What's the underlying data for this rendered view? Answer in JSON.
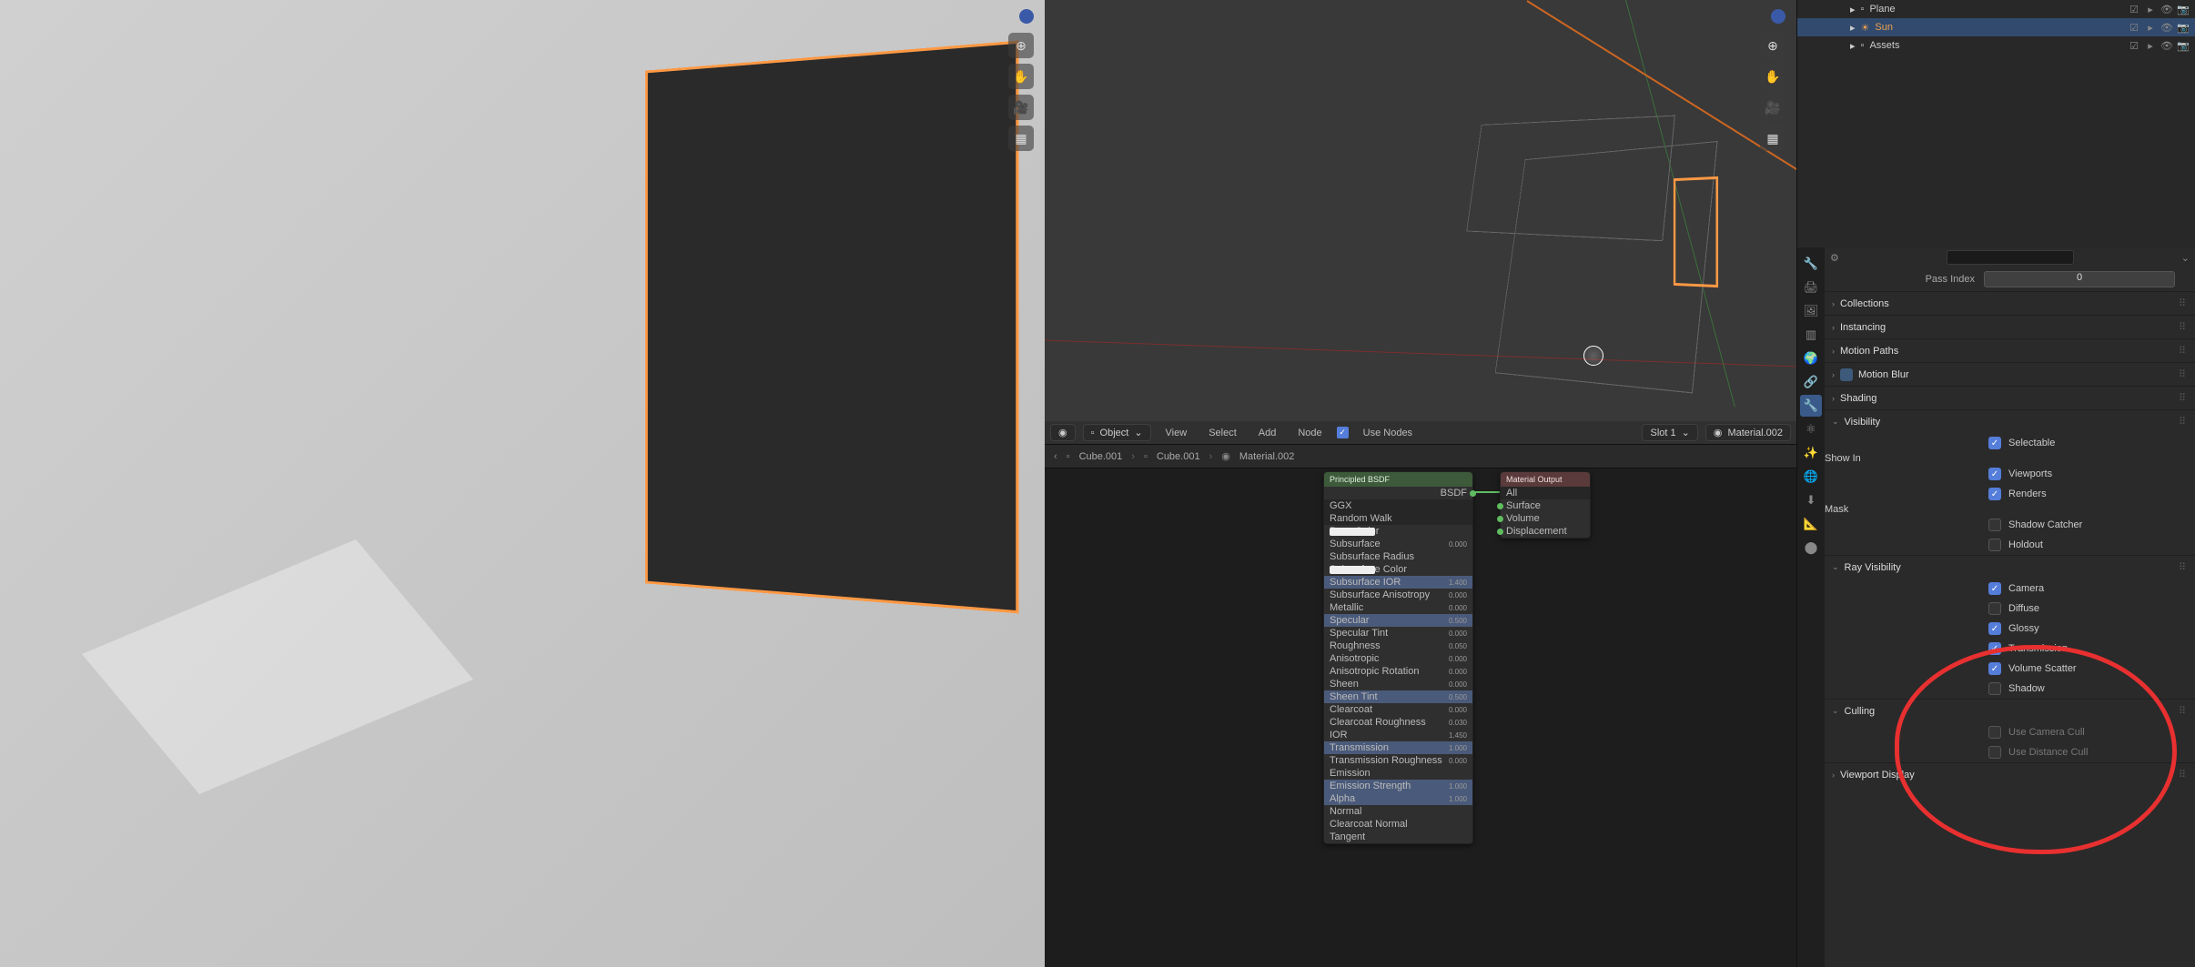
{
  "outliner": {
    "items": [
      {
        "name": "Plane",
        "icon": "▫"
      },
      {
        "name": "Sun",
        "icon": "☀",
        "class": "sun-lbl",
        "active": true
      },
      {
        "name": "Assets",
        "icon": "▫"
      }
    ]
  },
  "viewport_tools": [
    "⊕",
    "✋",
    "🎥",
    "▦"
  ],
  "node_editor": {
    "header": {
      "mode": "Object",
      "menus": [
        "View",
        "Select",
        "Add",
        "Node"
      ],
      "use_nodes": "Use Nodes",
      "slot": "Slot 1",
      "material": "Material.002"
    },
    "breadcrumb": [
      "Cube.001",
      "Cube.001",
      "Material.002"
    ],
    "bsdf": {
      "title": "Principled BSDF",
      "out": "BSDF",
      "rows": [
        {
          "l": "GGX",
          "v": "",
          "t": "dark"
        },
        {
          "l": "Random Walk",
          "v": "",
          "t": "dark"
        },
        {
          "l": "Base Color",
          "v": "",
          "t": "row",
          "color": true
        },
        {
          "l": "Subsurface",
          "v": "0.000",
          "t": "row"
        },
        {
          "l": "Subsurface Radius",
          "v": "",
          "t": "row"
        },
        {
          "l": "Subsurface Color",
          "v": "",
          "t": "row",
          "color": true
        },
        {
          "l": "Subsurface IOR",
          "v": "1.400",
          "t": "blue"
        },
        {
          "l": "Subsurface Anisotropy",
          "v": "0.000",
          "t": "row"
        },
        {
          "l": "Metallic",
          "v": "0.000",
          "t": "row"
        },
        {
          "l": "Specular",
          "v": "0.500",
          "t": "blue"
        },
        {
          "l": "Specular Tint",
          "v": "0.000",
          "t": "row"
        },
        {
          "l": "Roughness",
          "v": "0.050",
          "t": "row"
        },
        {
          "l": "Anisotropic",
          "v": "0.000",
          "t": "row"
        },
        {
          "l": "Anisotropic Rotation",
          "v": "0.000",
          "t": "row"
        },
        {
          "l": "Sheen",
          "v": "0.000",
          "t": "row"
        },
        {
          "l": "Sheen Tint",
          "v": "0.500",
          "t": "blue"
        },
        {
          "l": "Clearcoat",
          "v": "0.000",
          "t": "row"
        },
        {
          "l": "Clearcoat Roughness",
          "v": "0.030",
          "t": "row"
        },
        {
          "l": "IOR",
          "v": "1.450",
          "t": "row"
        },
        {
          "l": "Transmission",
          "v": "1.000",
          "t": "blue"
        },
        {
          "l": "Transmission Roughness",
          "v": "0.000",
          "t": "row"
        },
        {
          "l": "Emission",
          "v": "",
          "t": "row",
          "dark": true
        },
        {
          "l": "Emission Strength",
          "v": "1.000",
          "t": "blue"
        },
        {
          "l": "Alpha",
          "v": "1.000",
          "t": "blue"
        },
        {
          "l": "Normal",
          "v": "",
          "t": "row"
        },
        {
          "l": "Clearcoat Normal",
          "v": "",
          "t": "row"
        },
        {
          "l": "Tangent",
          "v": "",
          "t": "row"
        }
      ]
    },
    "output": {
      "title": "Material Output",
      "rows": [
        "All",
        "Surface",
        "Volume",
        "Displacement"
      ]
    }
  },
  "properties": {
    "pass_index": {
      "label": "Pass Index",
      "value": "0"
    },
    "panels_collapsed": [
      "Collections",
      "Instancing",
      "Motion Paths"
    ],
    "motion_blur": "Motion Blur",
    "shading": "Shading",
    "visibility": {
      "title": "Visibility",
      "selectable": "Selectable",
      "show_in": "Show In",
      "viewports": "Viewports",
      "renders": "Renders",
      "mask": "Mask",
      "shadow_catcher": "Shadow Catcher",
      "holdout": "Holdout"
    },
    "ray_visibility": {
      "title": "Ray Visibility",
      "camera": "Camera",
      "diffuse": "Diffuse",
      "glossy": "Glossy",
      "transmission": "Transmission",
      "volume_scatter": "Volume Scatter",
      "shadow": "Shadow"
    },
    "culling": {
      "title": "Culling",
      "camera": "Use Camera Cull",
      "distance": "Use Distance Cull"
    },
    "viewport_display": "Viewport Display"
  },
  "prop_tabs": [
    "🔧",
    "🖨",
    "🖼",
    "▥",
    "🌍",
    "🔗",
    "🔧",
    "⚛",
    "✨",
    "🌐",
    "⬇",
    "📐",
    "⬤"
  ]
}
